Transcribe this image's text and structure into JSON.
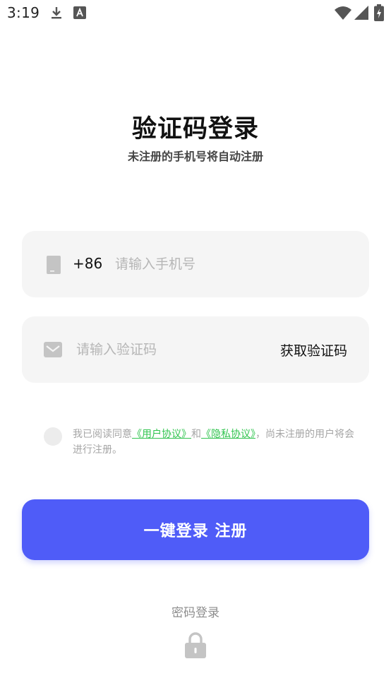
{
  "status_bar": {
    "time": "3:19",
    "icons": [
      "download-icon",
      "a-notification-icon",
      "wifi-icon",
      "signal-icon",
      "battery-charging-icon"
    ]
  },
  "header": {
    "title": "验证码登录",
    "subtitle": "未注册的手机号将自动注册"
  },
  "phone_field": {
    "icon": "phone-icon",
    "country_code": "+86",
    "value": "",
    "placeholder": "请输入手机号"
  },
  "code_field": {
    "icon": "mail-icon",
    "value": "",
    "placeholder": "请输入验证码",
    "get_code_label": "获取验证码"
  },
  "agreement": {
    "checked": false,
    "prefix": "我已阅读同意",
    "user_agreement": "《用户协议》",
    "connector": "和",
    "privacy_policy": "《隐私协议》",
    "suffix": "，尚未注册的用户将会进行注册。"
  },
  "actions": {
    "login_label": "一键登录 注册",
    "password_login_label": "密码登录",
    "lock_icon": "lock-icon"
  },
  "colors": {
    "accent": "#4f5cf8",
    "link": "#31c44f",
    "field_bg": "#f5f5f5",
    "placeholder": "#b6b6b6",
    "muted_text": "#a5a5a5"
  }
}
